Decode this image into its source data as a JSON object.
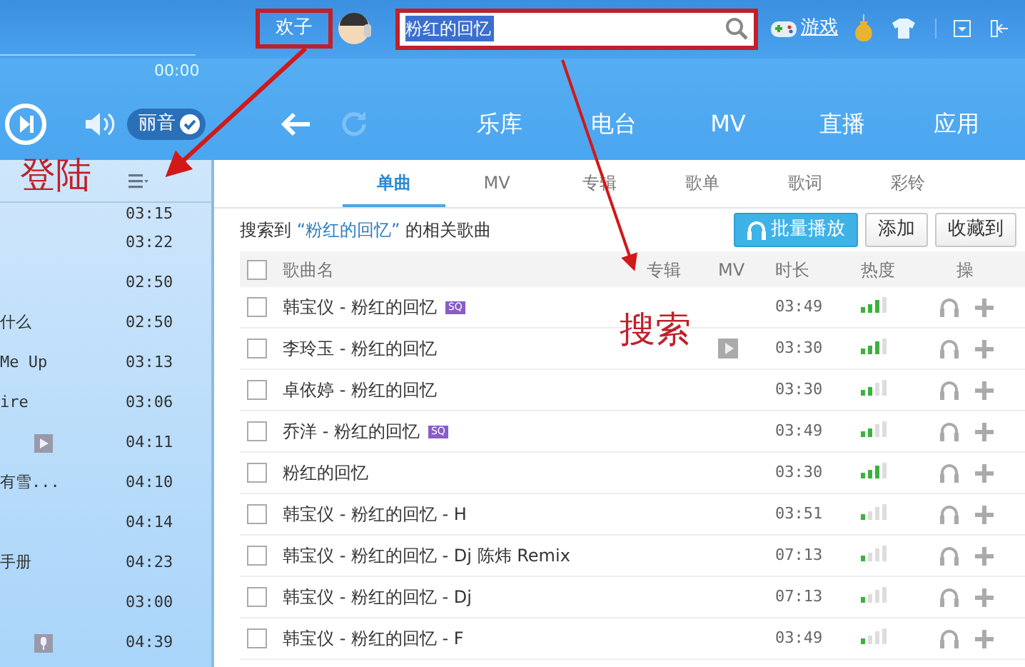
{
  "header": {
    "username": "欢子",
    "username_highlighted": true,
    "search": {
      "value": "粉红的回忆",
      "highlighted": true
    },
    "games_label": "游戏",
    "time": "00:00"
  },
  "player": {
    "quality_label": "丽音"
  },
  "nav": [
    {
      "label": "乐库"
    },
    {
      "label": "电台"
    },
    {
      "label": "MV"
    },
    {
      "label": "直播"
    },
    {
      "label": "应用"
    }
  ],
  "playlist": [
    {
      "kind": "none",
      "time": "03:15"
    },
    {
      "kind": "none",
      "time": "03:22"
    },
    {
      "kind": "none",
      "time": "02:50"
    },
    {
      "kind": "title",
      "title": "什么",
      "time": "02:50"
    },
    {
      "kind": "title",
      "title": "Me Up",
      "time": "03:13"
    },
    {
      "kind": "title",
      "title": "ire",
      "time": "03:06"
    },
    {
      "kind": "video",
      "time": "04:11"
    },
    {
      "kind": "title",
      "title": "有雪...",
      "time": "04:10"
    },
    {
      "kind": "none",
      "time": "04:14"
    },
    {
      "kind": "title",
      "title": "手册",
      "time": "04:23"
    },
    {
      "kind": "none",
      "time": "03:00"
    },
    {
      "kind": "mic",
      "time": "04:39"
    }
  ],
  "tabs": [
    {
      "label": "单曲",
      "selected": true
    },
    {
      "label": "MV",
      "selected": false
    },
    {
      "label": "专辑",
      "selected": false
    },
    {
      "label": "歌单",
      "selected": false
    },
    {
      "label": "歌词",
      "selected": false
    },
    {
      "label": "彩铃",
      "selected": false
    }
  ],
  "result": {
    "prefix": "搜索到",
    "query": "“粉红的回忆”",
    "suffix": "的相关歌曲"
  },
  "buttons": [
    {
      "label": "批量播放",
      "kind": "primary"
    },
    {
      "label": "添加",
      "kind": "plain"
    },
    {
      "label": "收藏到",
      "kind": "plain"
    }
  ],
  "table": {
    "all_checked": false,
    "columns": [
      "歌曲名",
      "专辑",
      "MV",
      "时长",
      "热度",
      "操"
    ],
    "rows": [
      {
        "title": "韩宝仪 - 粉红的回忆",
        "badge": "SQ",
        "sq": true,
        "mv": false,
        "duration": "03:49",
        "level": 0.75,
        "checked": false
      },
      {
        "title": "李玲玉 - 粉红的回忆",
        "sq": false,
        "mv": true,
        "duration": "03:30",
        "level": 0.75,
        "checked": false
      },
      {
        "title": "卓依婷 - 粉红的回忆",
        "sq": false,
        "mv": false,
        "duration": "03:30",
        "level": 0.5,
        "checked": false
      },
      {
        "title": "乔洋 - 粉红的回忆",
        "badge": "SQ",
        "sq": true,
        "mv": false,
        "duration": "03:49",
        "level": 0.5,
        "checked": false
      },
      {
        "title": "粉红的回忆",
        "sq": false,
        "mv": false,
        "duration": "03:30",
        "level": 0.75,
        "checked": false
      },
      {
        "title": "韩宝仪 - 粉红的回忆 - H",
        "sq": false,
        "mv": false,
        "duration": "03:51",
        "level": 0.25,
        "checked": false
      },
      {
        "title": "韩宝仪 - 粉红的回忆 - Dj 陈炜 Remix",
        "sq": false,
        "mv": false,
        "duration": "07:13",
        "level": 0.25,
        "checked": false
      },
      {
        "title": "韩宝仪 - 粉红的回忆 - Dj",
        "sq": false,
        "mv": false,
        "duration": "07:13",
        "level": 0.25,
        "checked": false
      },
      {
        "title": "韩宝仪 - 粉红的回忆 - F",
        "sq": false,
        "mv": false,
        "duration": "03:49",
        "level": 0.25,
        "checked": false
      }
    ]
  },
  "annotations": [
    {
      "text": "登陆"
    },
    {
      "text": "搜索"
    }
  ]
}
